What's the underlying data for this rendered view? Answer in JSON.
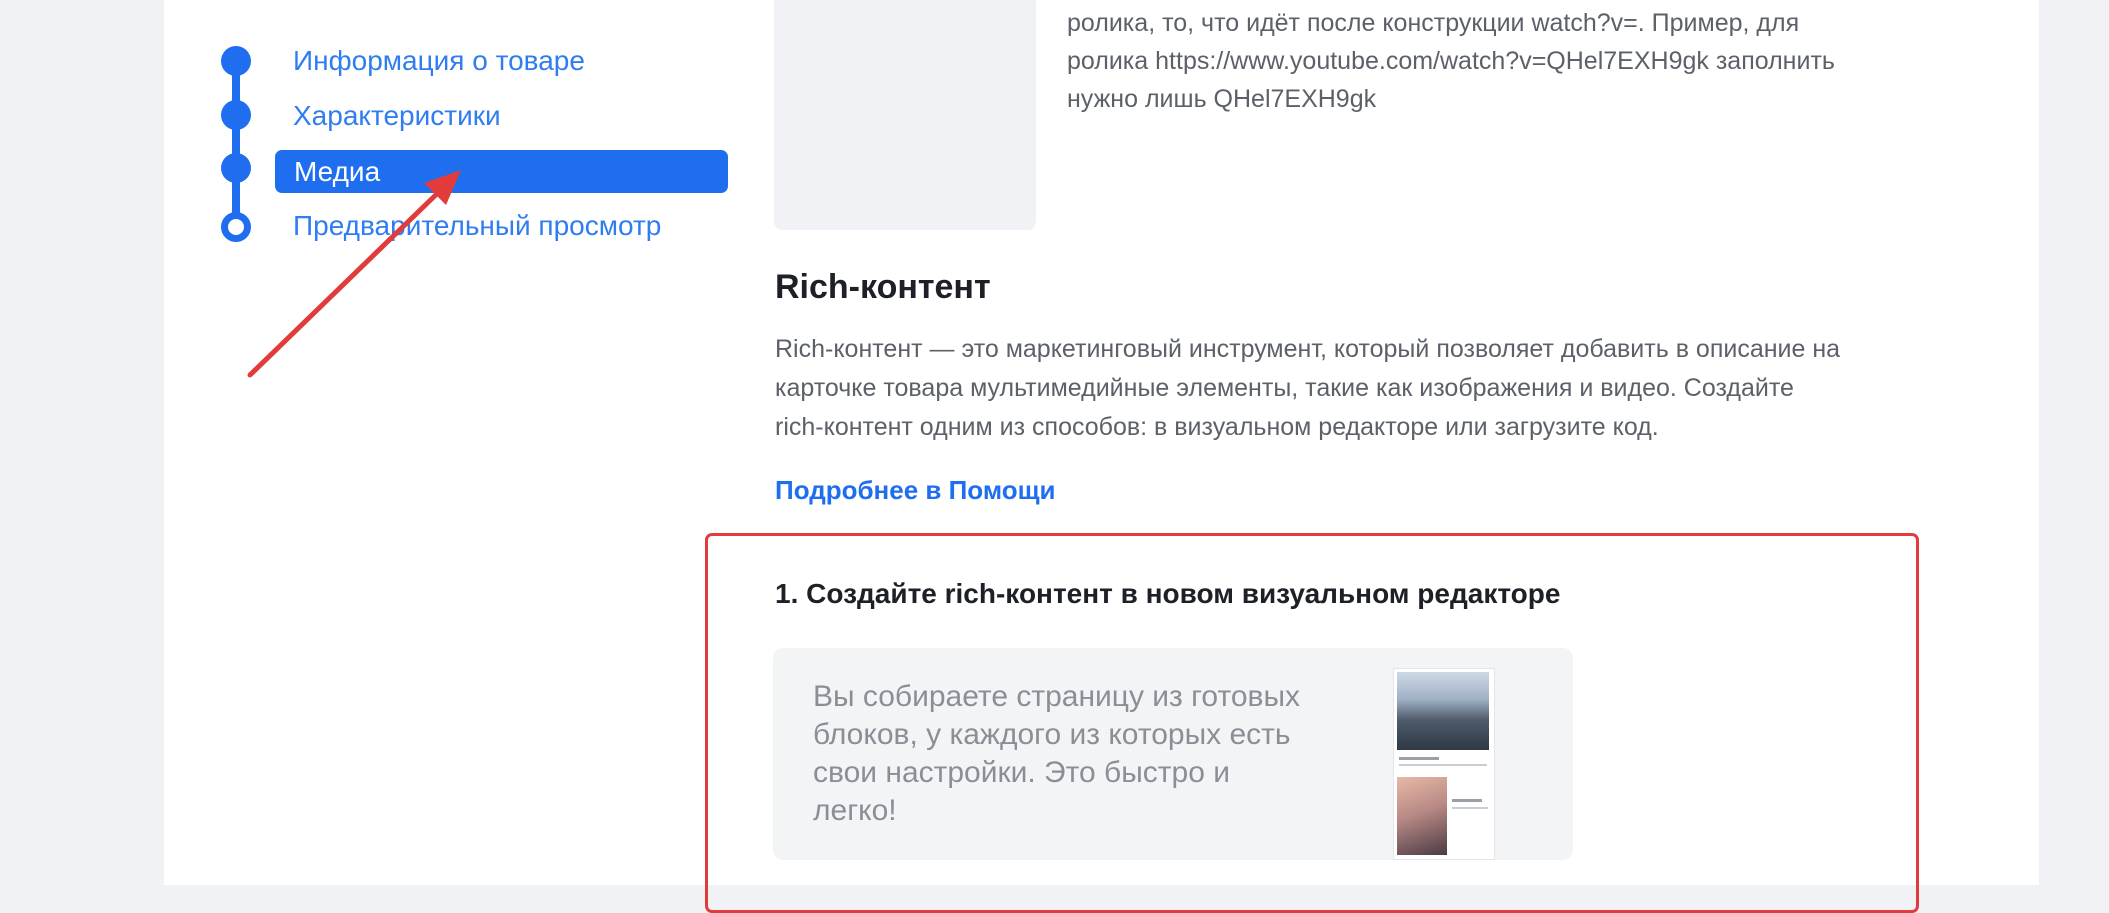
{
  "steps": [
    {
      "label": "Информация о товаре",
      "state": "done"
    },
    {
      "label": "Характеристики",
      "state": "done"
    },
    {
      "label": "Медиа",
      "state": "active"
    },
    {
      "label": "Предварительный просмотр",
      "state": "pending"
    }
  ],
  "video": {
    "hint_lines": [
      "ролика, то, что идёт после конструкции watch?v=. Пример, для",
      "ролика https://www.youtube.com/watch?v=QHel7EXH9gk заполнить",
      "нужно лишь QHel7EXH9gk"
    ]
  },
  "rich": {
    "title": "Rich-контент",
    "description_lines": [
      "Rich-контент — это маркетинговый инструмент, который позволяет добавить в описание на",
      "карточке товара мультимедийные элементы, такие как изображения и видео. Создайте",
      "rich-контент одним из способов: в визуальном редакторе или загрузите код."
    ],
    "help_link": "Подробнее в Помощи",
    "option1": {
      "title": "1. Создайте rich-контент в новом визуальном редакторе",
      "description_lines": [
        "Вы собираете страницу из готовых",
        "блоков, у каждого из которых есть",
        "свои настройки. Это быстро и",
        "легко!"
      ]
    }
  },
  "colors": {
    "accent": "#1f6ef0",
    "link": "#2f7df0",
    "annotation": "#e23b3b",
    "page_bg": "#f1f2f5"
  }
}
